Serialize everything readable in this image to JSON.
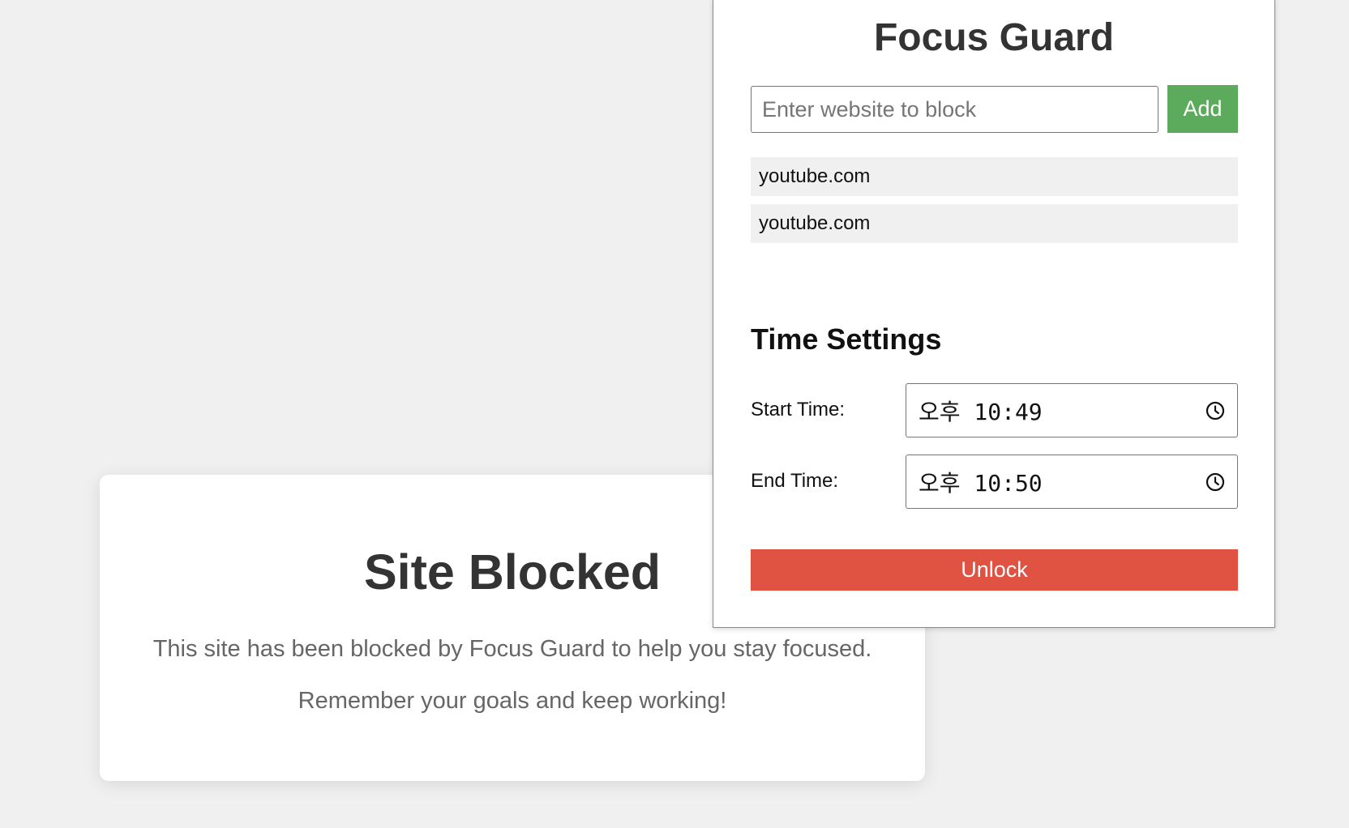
{
  "blocked_page": {
    "title": "Site Blocked",
    "message": "This site has been blocked by Focus Guard to help you stay focused.",
    "reminder": "Remember your goals and keep working!"
  },
  "popup": {
    "title": "Focus Guard",
    "site_input": {
      "placeholder": "Enter website to block",
      "value": ""
    },
    "add_label": "Add",
    "blocked_sites": [
      "youtube.com",
      "youtube.com"
    ],
    "time_settings": {
      "heading": "Time Settings",
      "start_label": "Start Time:",
      "start_value": "오후 10:49",
      "end_label": "End Time:",
      "end_value": "오후 10:50",
      "icon": "clock-icon"
    },
    "unlock_label": "Unlock"
  },
  "colors": {
    "page_background": "#f0f0f0",
    "add_button": "#5cab5c",
    "unlock_button": "#e05343",
    "site_item_background": "#f0f0f0",
    "heading_text": "#333333",
    "muted_text": "#666666"
  }
}
